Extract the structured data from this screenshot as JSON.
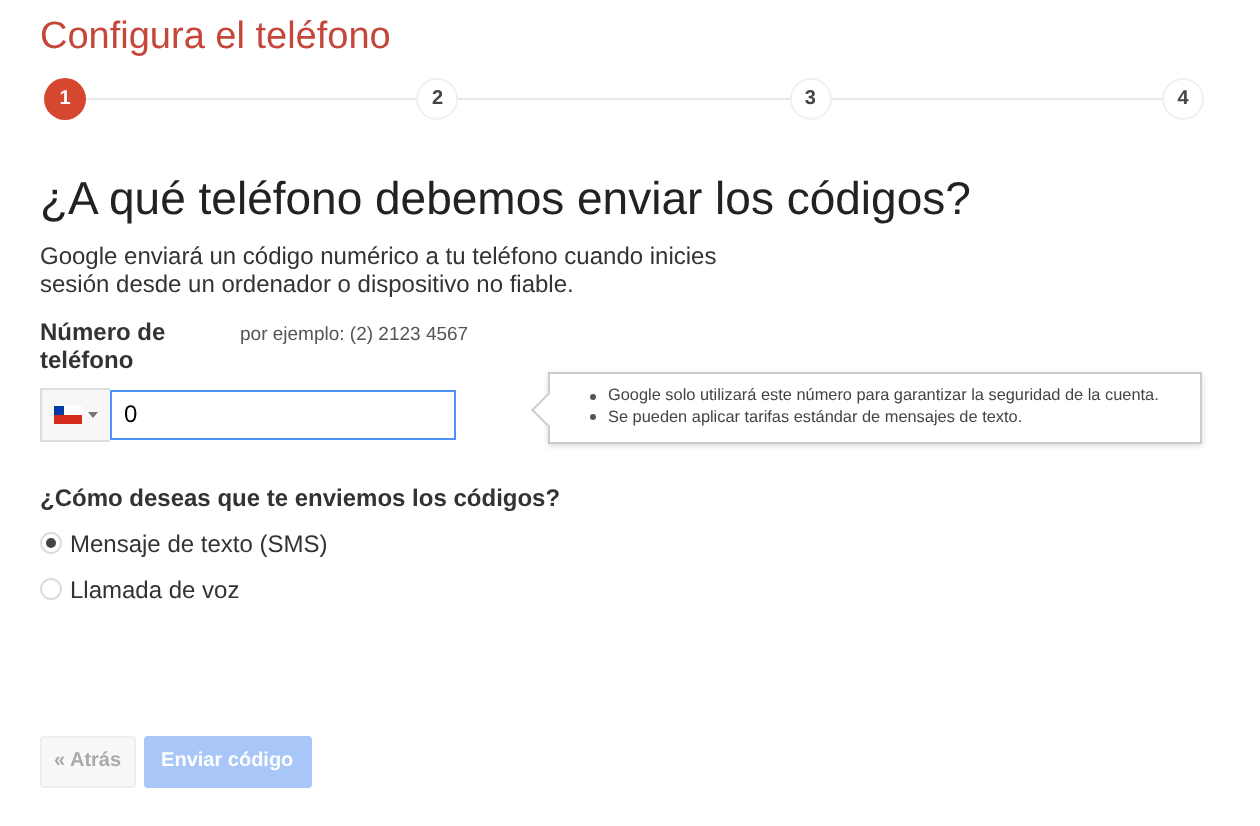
{
  "title": "Configura el teléfono",
  "steps": [
    {
      "label": "1",
      "selected": true
    },
    {
      "label": "2",
      "selected": false
    },
    {
      "label": "3",
      "selected": false
    },
    {
      "label": "4",
      "selected": false
    }
  ],
  "heading": "¿A qué teléfono debemos enviar los códigos?",
  "description": "Google enviará un código numérico a tu teléfono cuando inicies sesión desde un ordenador o dispositivo no fiable.",
  "phone": {
    "label": "Número de teléfono",
    "example": "por ejemplo: (2) 2123 4567",
    "value": "0"
  },
  "tips": [
    "Google solo utilizará este número para garantizar la seguridad de la cuenta.",
    "Se pueden aplicar tarifas estándar de mensajes de texto."
  ],
  "method_question": "¿Cómo deseas que te enviemos los códigos?",
  "methods": [
    {
      "label": "Mensaje de texto (SMS)",
      "selected": true
    },
    {
      "label": "Llamada de voz",
      "selected": false
    }
  ],
  "buttons": [
    {
      "kind": "back",
      "label": "« Atrás",
      "disabled": true
    },
    {
      "kind": "primary",
      "label": "Enviar código",
      "disabled": true
    }
  ]
}
